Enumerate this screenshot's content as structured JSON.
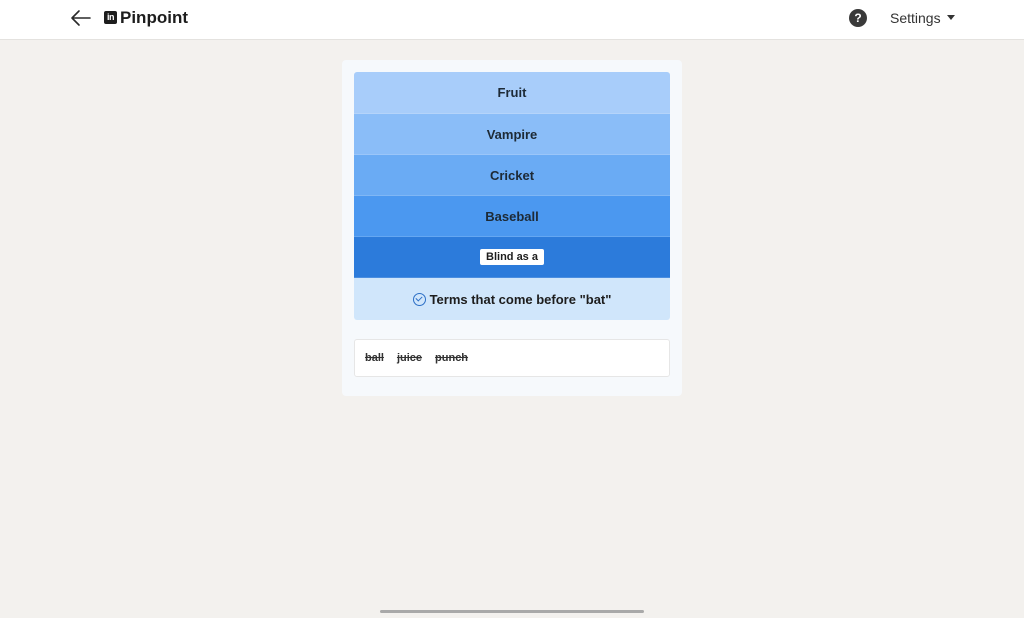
{
  "header": {
    "app_title": "Pinpoint",
    "logo_text": "in",
    "back_icon": "arrow-left-icon",
    "help_label": "?",
    "settings_label": "Settings"
  },
  "game": {
    "clues": [
      {
        "label": "Fruit"
      },
      {
        "label": "Vampire"
      },
      {
        "label": "Cricket"
      },
      {
        "label": "Baseball"
      },
      {
        "label": "Blind as a"
      }
    ],
    "answer": "Terms that come before \"bat\"",
    "guesses": [
      "ball",
      "juice",
      "punch"
    ]
  },
  "colors": {
    "clue_1": "#a8cdfa",
    "clue_2": "#8abdf8",
    "clue_3": "#6aabf4",
    "clue_4": "#4b98f0",
    "clue_5": "#2c7bdb",
    "answer_bg": "#d0e6fb"
  }
}
